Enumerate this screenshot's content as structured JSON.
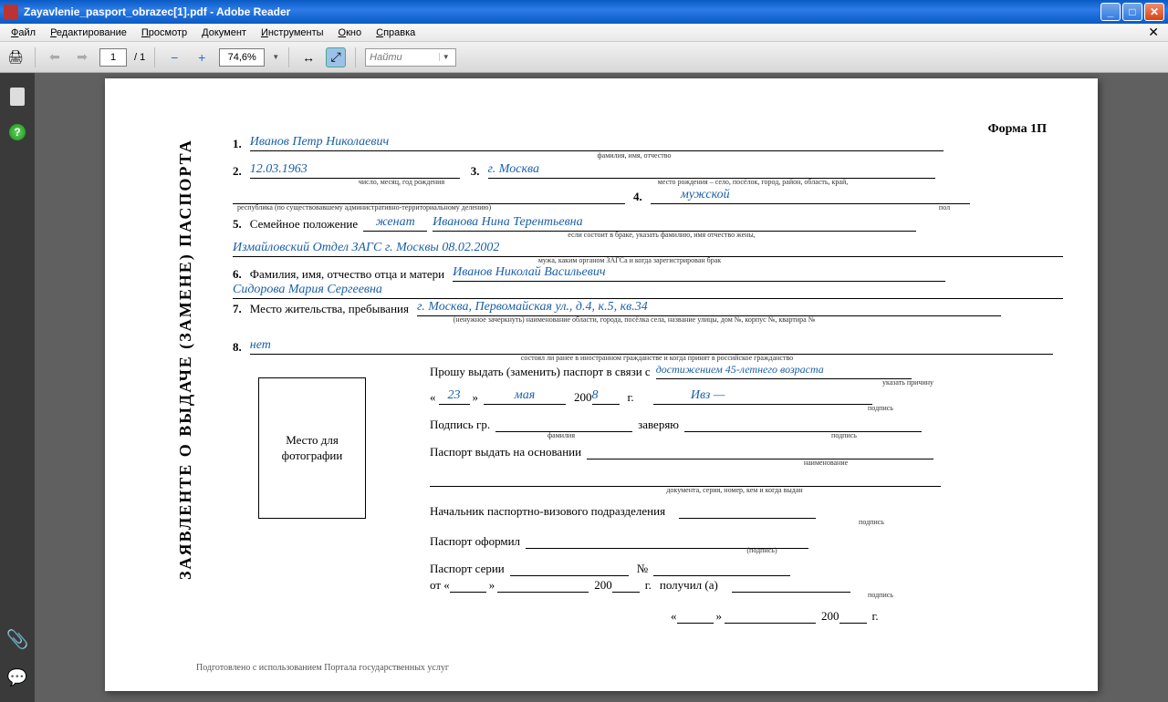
{
  "window": {
    "title": "Zayavlenie_pasport_obrazec[1].pdf - Adobe Reader"
  },
  "menu": {
    "file": "Файл",
    "edit": "Редактирование",
    "view": "Просмотр",
    "document": "Документ",
    "tools": "Инструменты",
    "window": "Окно",
    "help": "Справка"
  },
  "toolbar": {
    "page_current": "1",
    "page_total": "/ 1",
    "zoom": "74,6%",
    "find_placeholder": "Найти"
  },
  "doc": {
    "form_name": "Форма 1П",
    "vtitle": "ЗАЯВЛЕНТЕ О ВЫДАЧЕ (ЗАМЕНЕ) ПАСПОРТА",
    "n1": "1.",
    "fio": "Иванов Петр Николаевич",
    "h_fio": "фамилия, имя, отчество",
    "n2": "2.",
    "dob": "12.03.1963",
    "h_dob": "число, месяц, год рождения",
    "n3": "3.",
    "pob": "г. Москва",
    "h_pob": "место рождения – село, посёлок, город, район, область, край,",
    "h_rep": "республика (по существовавшему административно-территориальному делению)",
    "n4": "4.",
    "sex": "мужской",
    "h_sex": "пол",
    "n5": "5.",
    "l5": "Семейное положение",
    "marital": "женат",
    "spouse": "Иванова Нина Терентьевна",
    "h_spouse": "если состоит в браке, указать фамилию, имя отчество жены,",
    "zags": "Измайловский Отдел ЗАГС г. Москвы   08.02.2002",
    "h_zags": "мужа, каким органом ЗАГСа и когда зарегистрирован брак",
    "n6": "6.",
    "l6": "Фамилия, имя, отчество отца и матери",
    "father": "Иванов Николай Васильевич",
    "mother": "Сидорова Мария Сергеевна",
    "n7": "7.",
    "l7": "Место жительства, пребывания",
    "addr": "г. Москва, Первомайская ул., д.4, к.5, кв.34",
    "h_addr": "(ненужное зачеркнуть) наименование области, города, посёлка села, название улицы, дом №, корпус №, квартира №",
    "n8": "8.",
    "no": "нет",
    "h_prev": "состоял ли ранее в иностранном гражданстве и когда принят в российское гражданство",
    "l_request": "Прошу выдать (заменить) паспорт в связи с",
    "reason": "достижением 45-летнего возраста",
    "h_reason": "указать причину",
    "q1": "«",
    "day": "23",
    "q2": "»",
    "month": "мая",
    "yprefix": "200",
    "ysuffix": "8",
    "yr": "г.",
    "sign": "Ивз —",
    "h_sign": "подпись",
    "l_sig": "Подпись гр.",
    "h_surname": "фамилия",
    "l_cert": "заверяю",
    "l_basis": "Паспорт выдать на основании",
    "h_basis": "наименование",
    "h_docinfo": "документа, серия, номер, кем и когда выдан",
    "l_chief": "Начальник паспортно-визового подразделения",
    "l_issued": "Паспорт оформил",
    "h_sig2": "(подпись)",
    "l_series": "Паспорт серии",
    "numsign": "№",
    "l_from": "от «",
    "l_recv": "получил (а)",
    "photo": "Место для фотографии",
    "footer": "Подготовлено с использованием Портала государственных услуг"
  }
}
